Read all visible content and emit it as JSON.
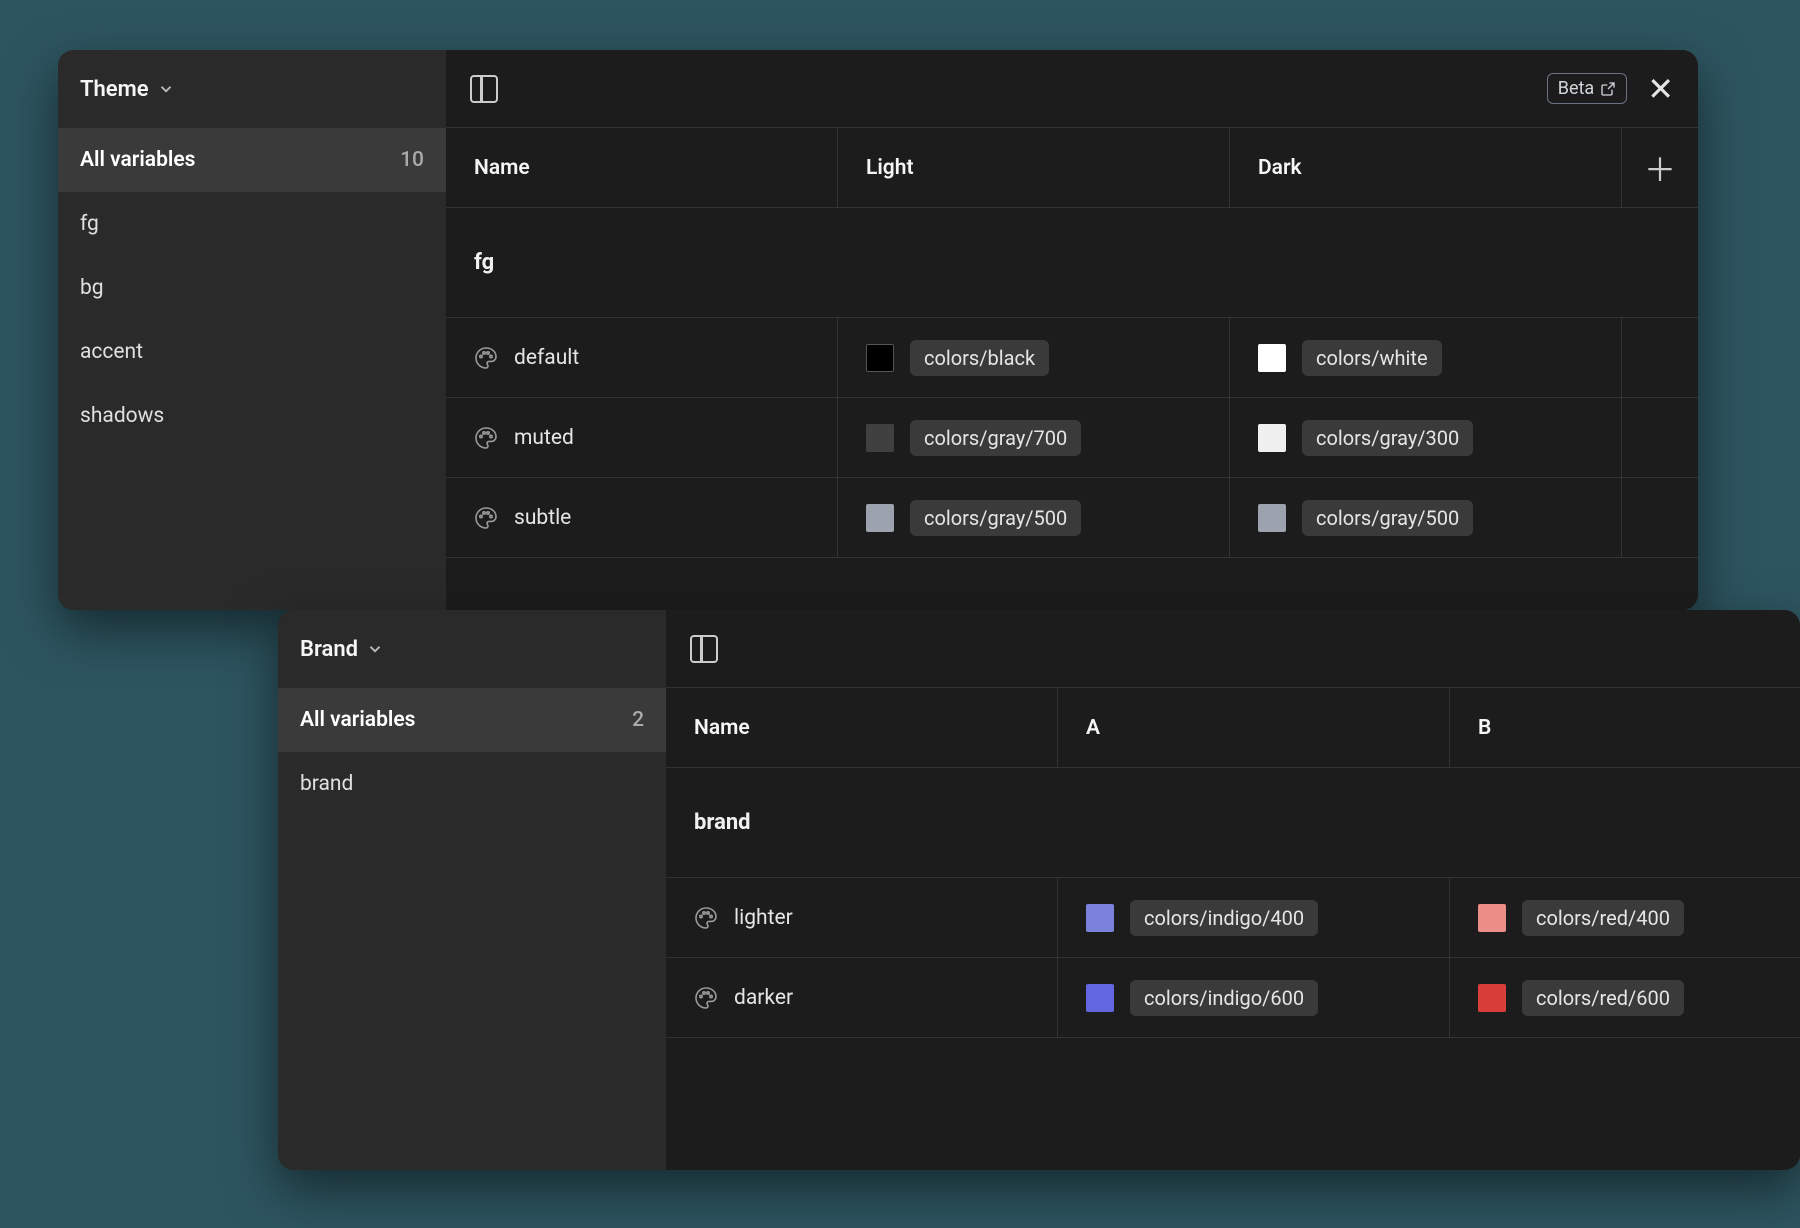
{
  "panels": {
    "theme": {
      "title": "Theme",
      "beta_label": "Beta",
      "all_variables_label": "All variables",
      "all_variables_count": "10",
      "groups_nav": [
        "fg",
        "bg",
        "accent",
        "shadows"
      ],
      "columns": {
        "name": "Name",
        "mode1": "Light",
        "mode2": "Dark"
      },
      "group_label": "fg",
      "rows": [
        {
          "name": "default",
          "light": {
            "label": "colors/black",
            "color": "#000000",
            "bordered": true
          },
          "dark": {
            "label": "colors/white",
            "color": "#ffffff",
            "bordered": false
          }
        },
        {
          "name": "muted",
          "light": {
            "label": "colors/gray/700",
            "color": "#404040",
            "bordered": false
          },
          "dark": {
            "label": "colors/gray/300",
            "color": "#f0f0f0",
            "bordered": false
          }
        },
        {
          "name": "subtle",
          "light": {
            "label": "colors/gray/500",
            "color": "#9da3ae",
            "bordered": false
          },
          "dark": {
            "label": "colors/gray/500",
            "color": "#9da3ae",
            "bordered": false
          }
        }
      ]
    },
    "brand": {
      "title": "Brand",
      "all_variables_label": "All variables",
      "all_variables_count": "2",
      "groups_nav": [
        "brand"
      ],
      "columns": {
        "name": "Name",
        "mode1": "A",
        "mode2": "B"
      },
      "group_label": "brand",
      "rows": [
        {
          "name": "lighter",
          "a": {
            "label": "colors/indigo/400",
            "color": "#7b82db"
          },
          "b": {
            "label": "colors/red/400",
            "color": "#ec8d87"
          }
        },
        {
          "name": "darker",
          "a": {
            "label": "colors/indigo/600",
            "color": "#6266df"
          },
          "b": {
            "label": "colors/red/600",
            "color": "#da3e3a"
          }
        }
      ]
    }
  }
}
